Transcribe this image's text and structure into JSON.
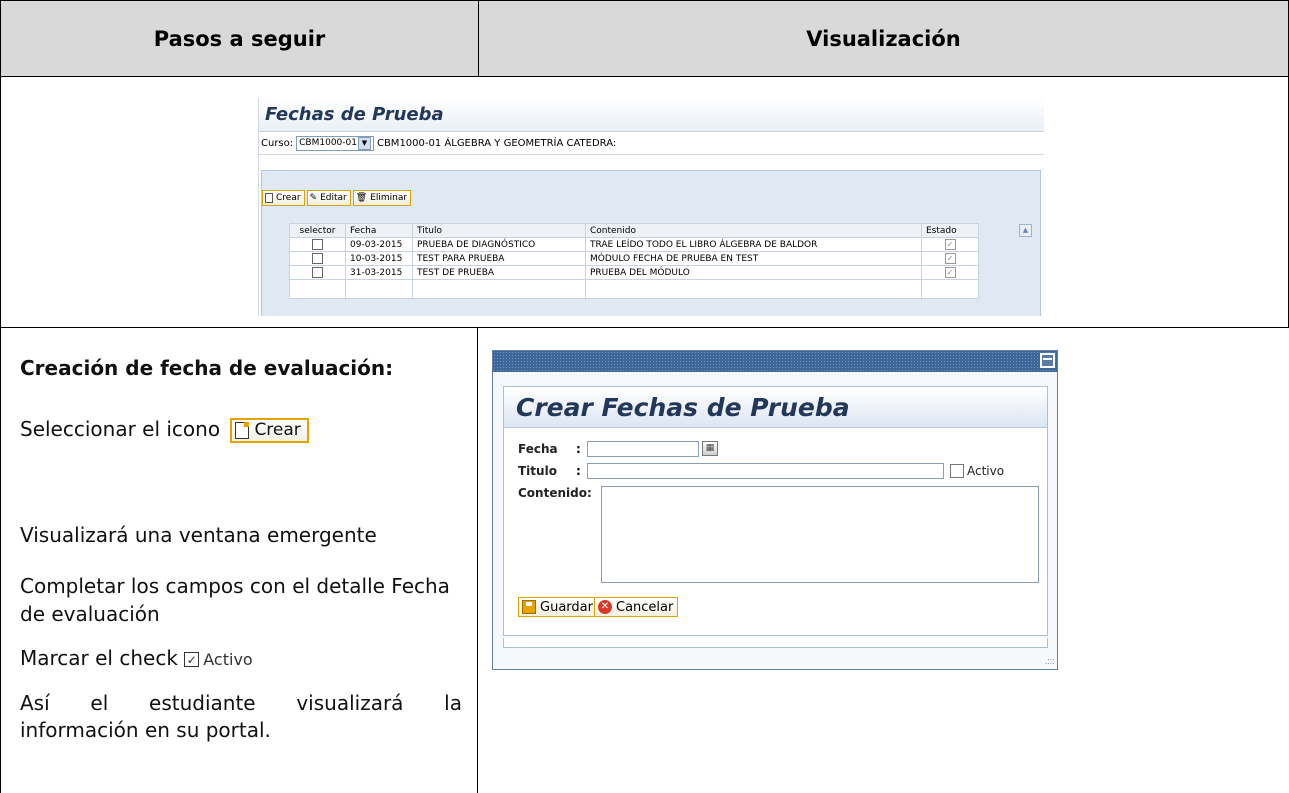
{
  "header": {
    "left_title": "Pasos a seguir",
    "right_title": "Visualización"
  },
  "instructions": {
    "title": "Creación de fecha de evaluación:",
    "select_icon_text": "Seleccionar el icono",
    "create_button_label": "Crear",
    "popup_text": "Visualizará una ventana emergente",
    "complete_text": "Completar los campos con el detalle Fecha de evaluación",
    "mark_check_text": "Marcar el check",
    "active_label": "Activo",
    "student_line1": "Así el estudiante visualizará la",
    "student_line2": "información en su portal."
  },
  "fechas_screen": {
    "title": "Fechas de Prueba",
    "course_label": "Curso:",
    "course_code": "CBM1000-01",
    "course_name": "CBM1000-01 ÁLGEBRA Y GEOMETRÍA CATEDRA:",
    "toolbar": {
      "create": "Crear",
      "edit": "Editar",
      "delete": "Eliminar"
    },
    "columns": [
      "selector",
      "Fecha",
      "Titulo",
      "Contenido",
      "Estado"
    ],
    "rows": [
      {
        "fecha": "09-03-2015",
        "titulo": "PRUEBA DE DIAGNÓSTICO",
        "contenido": "TRAE LEÍDO TODO EL LIBRO ÁLGEBRA DE BALDOR",
        "estado": true
      },
      {
        "fecha": "10-03-2015",
        "titulo": "TEST PARA PRUEBA",
        "contenido": "MÓDULO FECHA DE PRUEBA EN TEST",
        "estado": true
      },
      {
        "fecha": "31-03-2015",
        "titulo": "TEST DE PRUEBA",
        "contenido": "PRUEBA DEL MÓDULO",
        "estado": true
      }
    ]
  },
  "crear_dialog": {
    "title": "Crear Fechas de Prueba",
    "fecha_label": "Fecha",
    "titulo_label": "Titulo",
    "contenido_label": "Contenido:",
    "colon": ":",
    "active_label": "Activo",
    "save_button": "Guardar",
    "cancel_button": "Cancelar"
  }
}
